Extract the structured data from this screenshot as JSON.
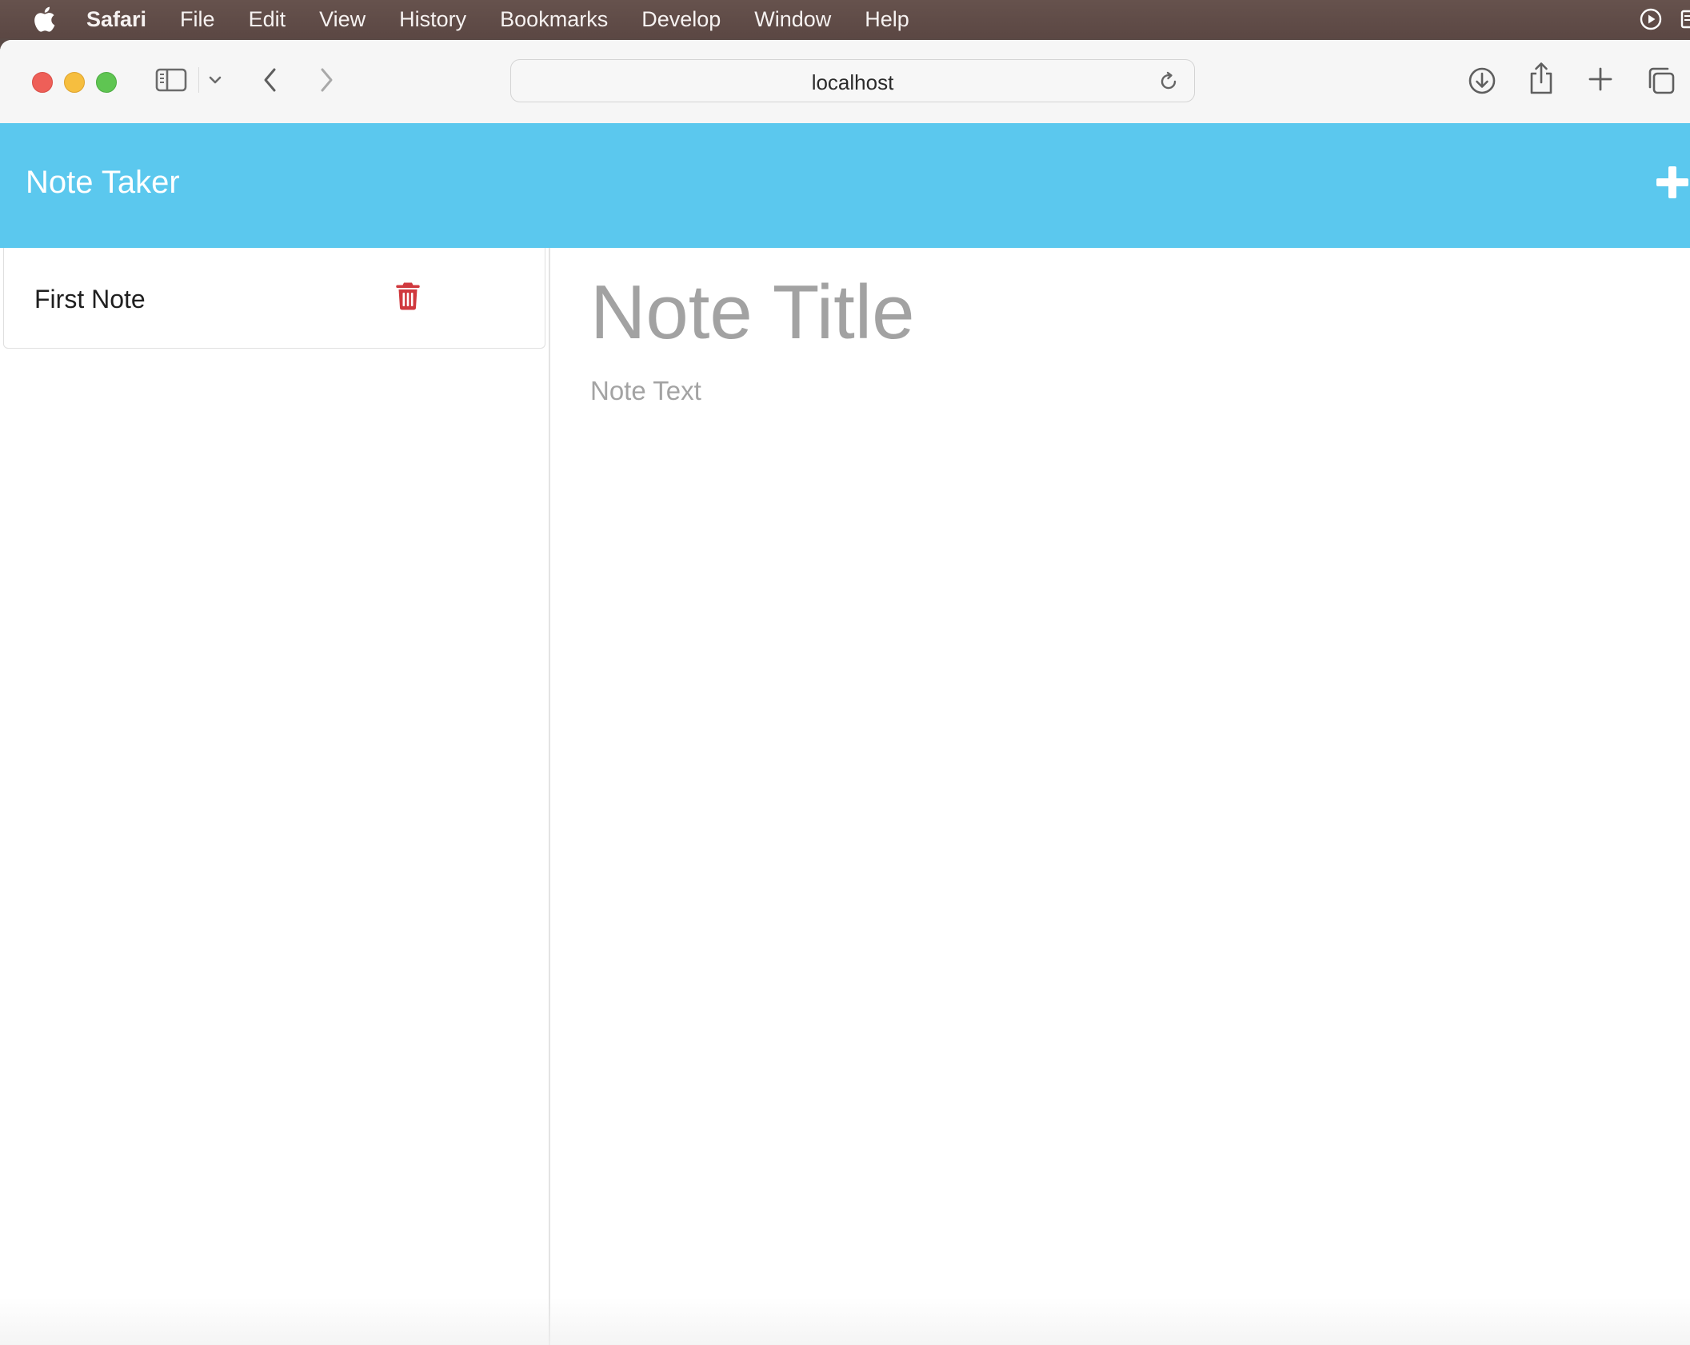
{
  "menubar": {
    "app_name": "Safari",
    "items": [
      "File",
      "Edit",
      "View",
      "History",
      "Bookmarks",
      "Develop",
      "Window",
      "Help"
    ]
  },
  "browser": {
    "url": "localhost",
    "icons": [
      "sidebar-icon",
      "chevron-down-icon",
      "back-icon",
      "forward-icon",
      "reload-icon",
      "download-icon",
      "share-icon",
      "new-tab-icon",
      "tab-overview-icon"
    ]
  },
  "app": {
    "brand": "Note Taker",
    "header_color": "#5bc8ee",
    "notes": [
      {
        "title": "First Note"
      }
    ],
    "trash_color": "#d0393e",
    "editor": {
      "title_placeholder": "Note Title",
      "text_placeholder": "Note Text"
    }
  }
}
